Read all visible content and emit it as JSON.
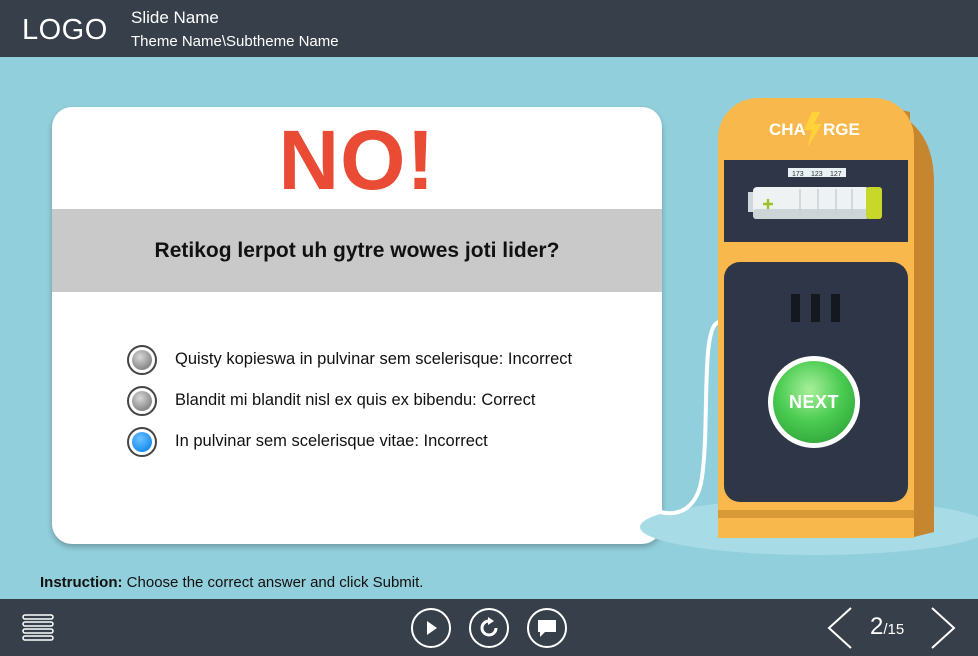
{
  "header": {
    "logo": "LOGO",
    "slide_name": "Slide Name",
    "theme_name": "Theme Name\\Subtheme Name"
  },
  "quiz": {
    "feedback": "NO!",
    "question": "Retikog lerpot uh gytre wowes joti lider?",
    "options": [
      {
        "label": "Quisty kopieswa in pulvinar sem scelerisque: Incorrect",
        "selected": false
      },
      {
        "label": "Blandit mi blandit nisl ex quis ex bibendu: Correct",
        "selected": false
      },
      {
        "label": "In pulvinar sem scelerisque vitae: Incorrect",
        "selected": true
      }
    ]
  },
  "instruction": {
    "label": "Instruction:",
    "text": "Choose the correct answer and click Submit."
  },
  "pump": {
    "title_left": "CHA",
    "title_right": "RGE",
    "counters": [
      "173",
      "123",
      "127"
    ],
    "next_button": "NEXT"
  },
  "footer": {
    "page_current": "2",
    "page_total": "/15"
  },
  "colors": {
    "background": "#92cfdc",
    "bar": "#37404a",
    "feedback_red": "#e94b35",
    "pump_orange": "#f9b84b",
    "pump_panel": "#2f3647",
    "next_green": "#3dbb4a",
    "radio_selected": "#1a8ff0"
  },
  "icons": [
    "menu-icon",
    "play-icon",
    "replay-icon",
    "comment-icon",
    "prev-arrow-icon",
    "next-arrow-icon",
    "lightning-icon",
    "battery-icon"
  ]
}
